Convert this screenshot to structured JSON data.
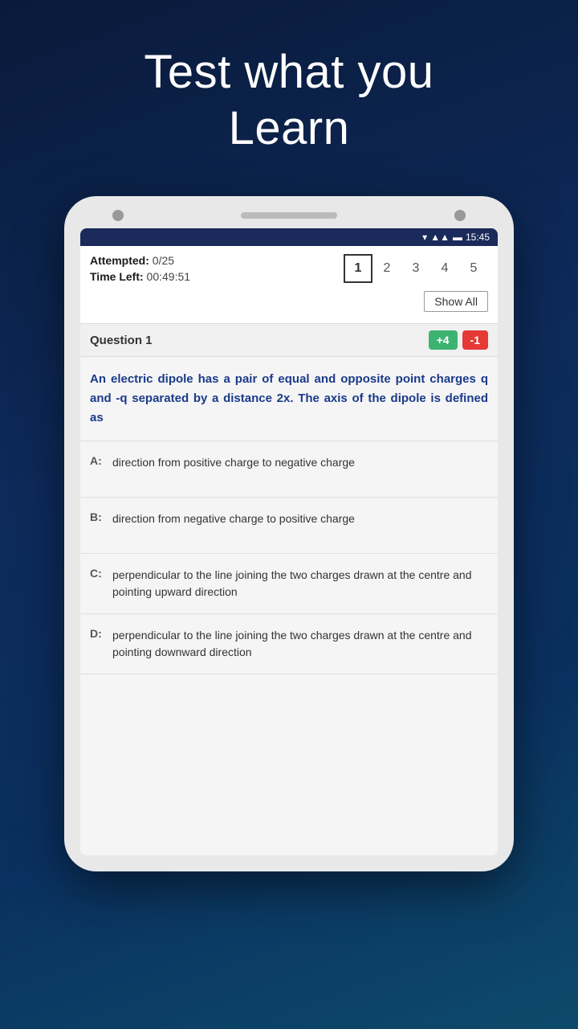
{
  "hero": {
    "title_line1": "Test what you",
    "title_line2": "Learn"
  },
  "status_bar": {
    "time": "15:45"
  },
  "quiz": {
    "attempted_label": "Attempted:",
    "attempted_value": "0/25",
    "time_left_label": "Time Left:",
    "time_left_value": "00:49:51",
    "question_numbers": [
      "1",
      "2",
      "3",
      "4",
      "5"
    ],
    "active_question": 0,
    "show_all_label": "Show All",
    "question_label": "Question 1",
    "score_positive": "+4",
    "score_negative": "-1",
    "question_text": "An electric dipole has a pair of equal and opposite point charges q and -q separated by a distance 2x. The axis of the dipole is defined as",
    "options": [
      {
        "label": "A:",
        "text": "direction from positive charge to negative charge"
      },
      {
        "label": "B:",
        "text": "direction from negative charge to positive charge"
      },
      {
        "label": "C:",
        "text": "perpendicular to the line joining the two charges drawn at the centre and pointing upward direction"
      },
      {
        "label": "D:",
        "text": "perpendicular to the line joining the two charges drawn at the centre and pointing downward direction"
      }
    ]
  }
}
